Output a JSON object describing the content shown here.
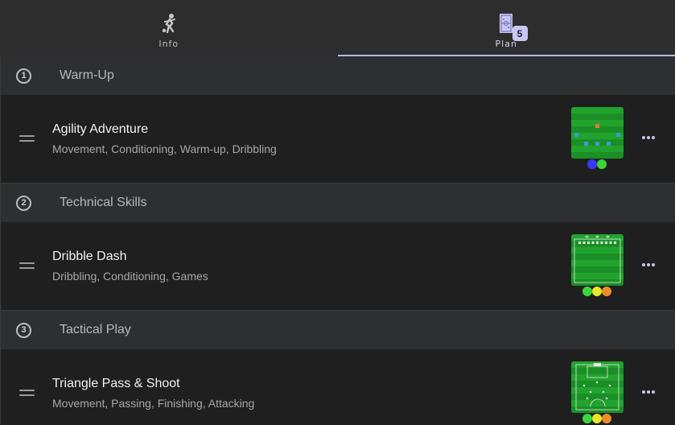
{
  "tabs": [
    {
      "label": "Info",
      "icon": "player-icon",
      "active": false
    },
    {
      "label": "Plan",
      "icon": "pitch-plan-icon",
      "active": true,
      "badge": "5"
    }
  ],
  "sections": [
    {
      "number": "1",
      "title": "Warm-Up",
      "drill": {
        "title": "Agility Adventure",
        "tags": "Movement, Conditioning, Warm-up, Dribbling",
        "level_colors": [
          "#3a3aff",
          "#3cd63c"
        ]
      }
    },
    {
      "number": "2",
      "title": "Technical Skills",
      "drill": {
        "title": "Dribble Dash",
        "tags": "Dribbling, Conditioning, Games",
        "level_colors": [
          "#3cd63c",
          "#e8e82a",
          "#f08c30"
        ]
      }
    },
    {
      "number": "3",
      "title": "Tactical Play",
      "drill": {
        "title": "Triangle Pass & Shoot",
        "tags": "Movement, Passing, Finishing, Attacking",
        "level_colors": [
          "#3cd63c",
          "#e8e82a",
          "#f08c30"
        ]
      }
    }
  ],
  "colors": {
    "accent": "#b8b8f0",
    "pitch": "#1e9a2a",
    "badge": "#c9c6f2"
  }
}
